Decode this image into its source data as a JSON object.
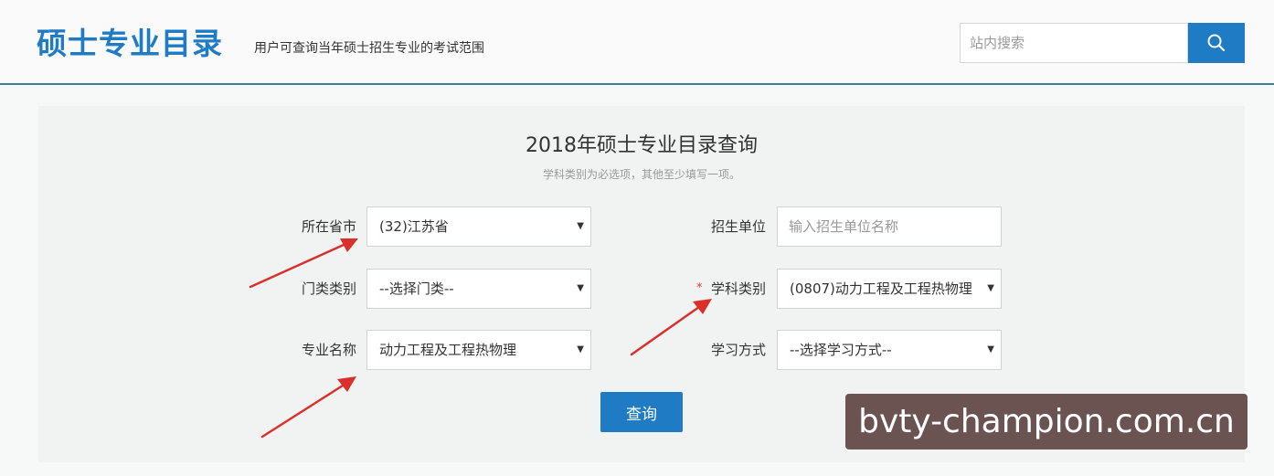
{
  "header": {
    "title": "硕士专业目录",
    "subtitle": "用户可查询当年硕士招生专业的考试范围",
    "search_placeholder": "站内搜索",
    "search_icon": "search-icon"
  },
  "form": {
    "title": "2018年硕士专业目录查询",
    "hint": "学科类别为必选项，其他至少填写一项。",
    "fields": {
      "province": {
        "label": "所在省市",
        "value": "(32)江苏省"
      },
      "institution": {
        "label": "招生单位",
        "placeholder": "输入招生单位名称"
      },
      "category": {
        "label": "门类类别",
        "value": "--选择门类--"
      },
      "discipline": {
        "label": "学科类别",
        "required_mark": "*",
        "value": "(0807)动力工程及工程热物理"
      },
      "major": {
        "label": "专业名称",
        "value": "动力工程及工程热物理"
      },
      "study_mode": {
        "label": "学习方式",
        "value": "--选择学习方式--"
      }
    },
    "submit_label": "查询",
    "caret": "▼"
  },
  "watermark": {
    "text": "bvty-champion.com.cn"
  },
  "colors": {
    "brand": "#1f7cc4",
    "header_rule": "#3c7f99",
    "annotation_arrow": "#d9302c",
    "watermark_bg": "#6b5352"
  }
}
